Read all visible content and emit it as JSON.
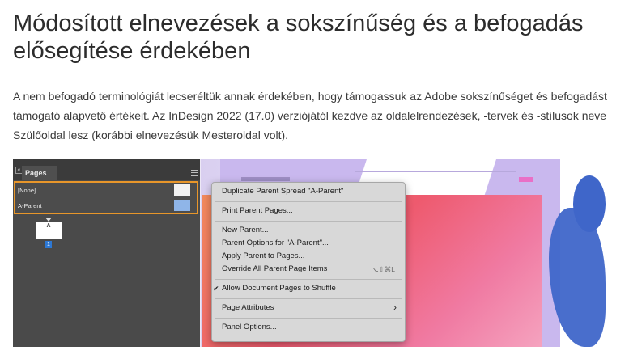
{
  "title": "Módosított elnevezések a sokszínűség és a befogadás elősegítése érdekében",
  "intro": "A nem befogadó terminológiát lecseréltük annak érdekében, hogy támogassuk az Adobe sokszínűséget és befogadást támogató alapvető értékeit. Az InDesign 2022 (17.0) verziójától kezdve az oldalelrendezések, -tervek és -stílusok neve Szülőoldal lesz (korábbi elnevezésük Mesteroldal volt).",
  "screenshot": {
    "pages_panel": {
      "tab_label": "Pages",
      "parents": [
        "[None]",
        "A-Parent"
      ],
      "page_thumb_letter": "A",
      "page_number": "1"
    },
    "context_menu": {
      "items": [
        "Duplicate Parent Spread \"A-Parent\"",
        "Print Parent Pages...",
        "New Parent...",
        "Parent Options for \"A-Parent\"...",
        "Apply Parent to Pages...",
        "Override All Parent Page Items",
        "Allow Document Pages to Shuffle",
        "Page Attributes",
        "Panel Options..."
      ],
      "override_shortcut": "⌥⇧⌘L",
      "checked_item": "Allow Document Pages to Shuffle"
    }
  }
}
